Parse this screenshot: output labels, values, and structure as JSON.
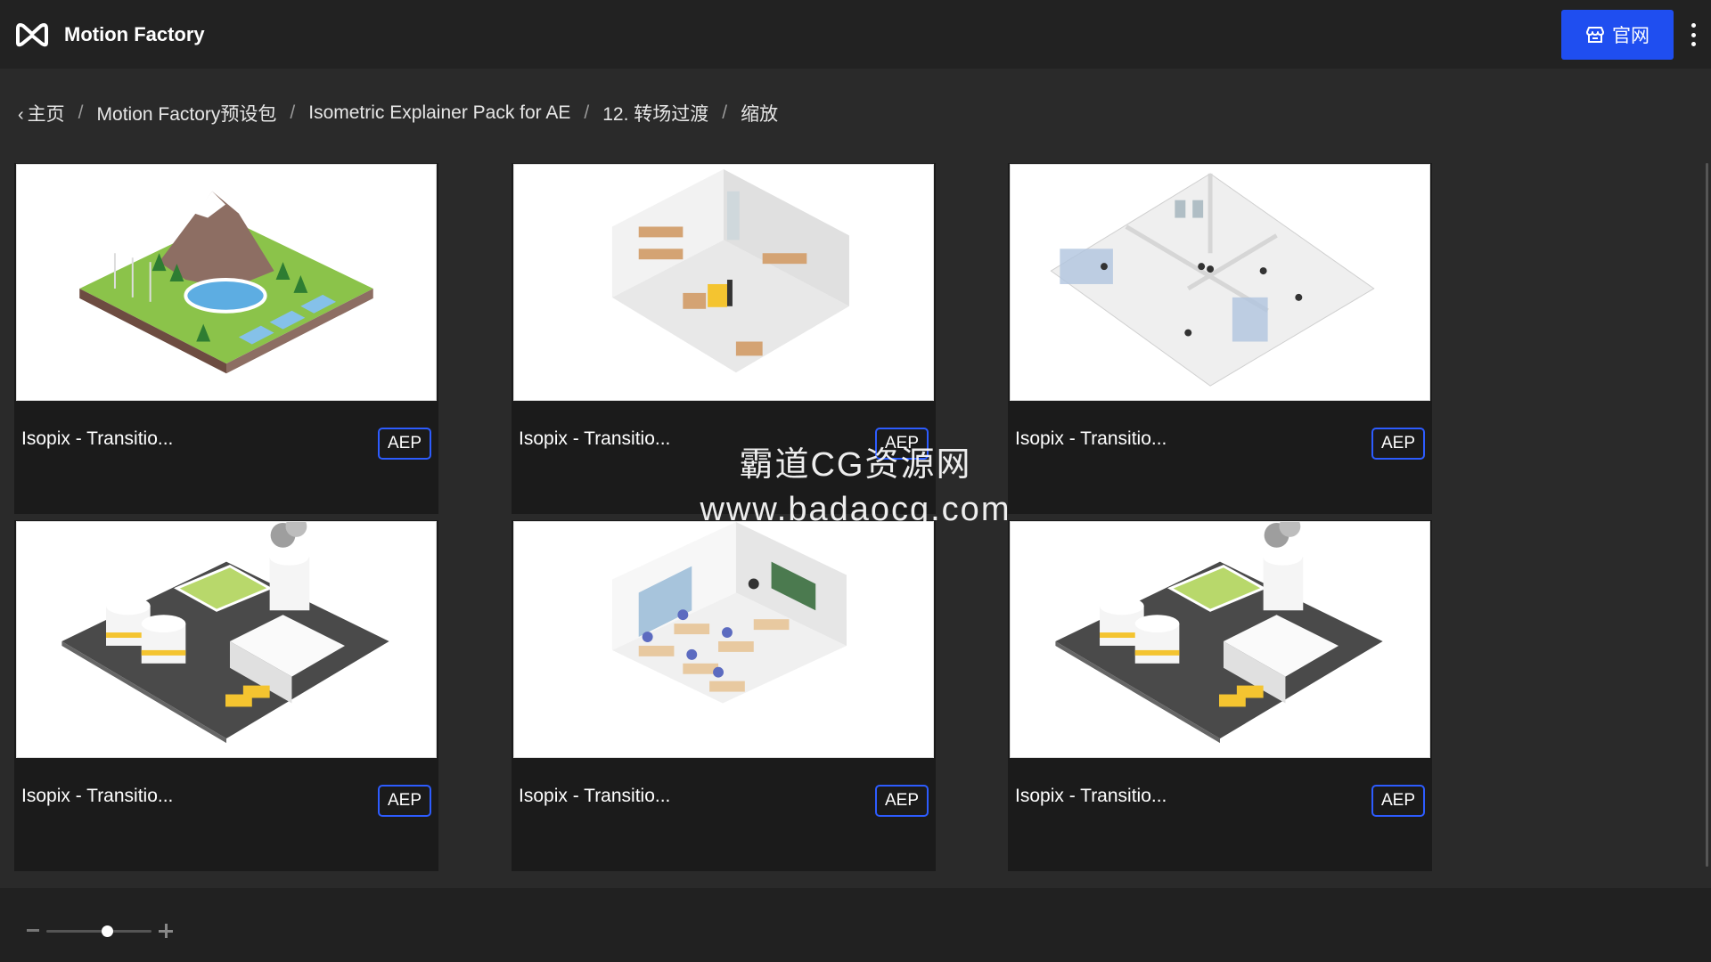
{
  "header": {
    "app_title": "Motion Factory",
    "site_button_label": "官网"
  },
  "breadcrumb": [
    "主页",
    "Motion Factory预设包",
    "Isometric Explainer Pack for AE",
    "12. 转场过渡",
    "缩放"
  ],
  "cards": [
    {
      "title": "Isopix - Transitio...",
      "badge": "AEP",
      "scene": "mountain"
    },
    {
      "title": "Isopix - Transitio...",
      "badge": "AEP",
      "scene": "warehouse"
    },
    {
      "title": "Isopix - Transitio...",
      "badge": "AEP",
      "scene": "office"
    },
    {
      "title": "Isopix - Transitio...",
      "badge": "AEP",
      "scene": "factory"
    },
    {
      "title": "Isopix - Transitio...",
      "badge": "AEP",
      "scene": "classroom"
    },
    {
      "title": "Isopix - Transitio...",
      "badge": "AEP",
      "scene": "factory"
    }
  ],
  "watermark": {
    "line1": "霸道CG资源网",
    "line2": "www.badaocg.com"
  },
  "zoom": {
    "level": 0.58
  },
  "colors": {
    "accent": "#1f4ef0",
    "badge_border": "#2d5cff",
    "background": "#2a2a2a",
    "card": "#1b1b1b"
  }
}
